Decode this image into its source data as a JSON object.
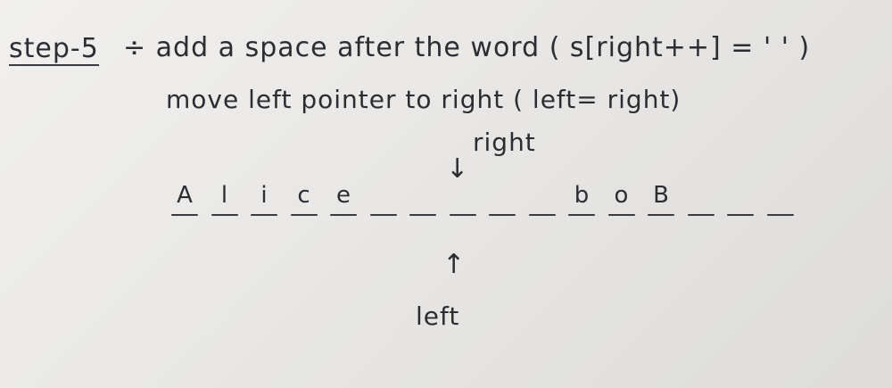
{
  "note": {
    "step_label": "step-5",
    "step_text": "÷ add a space after the word ( s[right++] = ' ' )",
    "line2": "move left pointer to right ( left= right)",
    "right_label": "right",
    "left_label": "left"
  },
  "cells": [
    "A",
    "l",
    "i",
    "c",
    "e",
    "",
    "",
    "",
    "",
    "",
    "b",
    "o",
    "B",
    "",
    "",
    ""
  ],
  "pointers": {
    "right_index": 6,
    "left_index": 6
  }
}
